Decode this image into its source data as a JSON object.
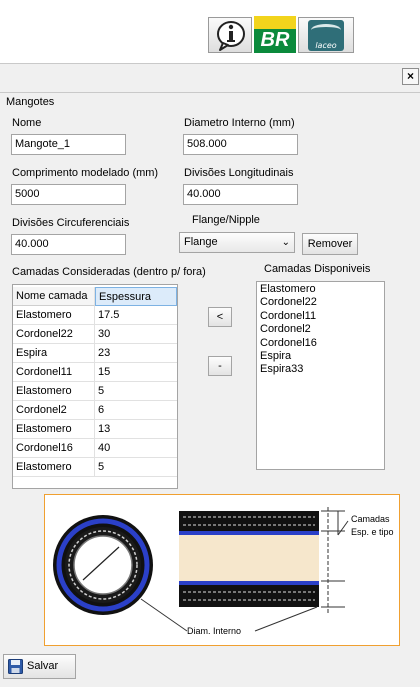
{
  "toolbar": {
    "info_icon": "info-icon",
    "br_logo_text": "BR",
    "laceo_logo_text": "laceo"
  },
  "close_label": "×",
  "group_title": "Mangotes",
  "form": {
    "nome_label": "Nome",
    "nome_value": "Mangote_1",
    "diametro_label": "Diametro Interno (mm)",
    "diametro_value": "508.000",
    "comprimento_label": "Comprimento modelado (mm)",
    "comprimento_value": "5000",
    "div_long_label": "Divisões Longitudinais",
    "div_long_value": "40.000",
    "div_circ_label": "Divisões Circuferenciais",
    "div_circ_value": "40.000",
    "flange_label": "Flange/Nipple",
    "flange_value": "Flange",
    "remover_label": "Remover"
  },
  "camadas_consideradas": {
    "title": "Camadas Consideradas (dentro p/ fora)",
    "headers": [
      "Nome camada",
      "Espessura"
    ],
    "rows": [
      [
        "Elastomero",
        "17.5"
      ],
      [
        "Cordonel22",
        "30"
      ],
      [
        "Espira",
        "23"
      ],
      [
        "Cordonel11",
        "15"
      ],
      [
        "Elastomero",
        "5"
      ],
      [
        "Cordonel2",
        "6"
      ],
      [
        "Elastomero",
        "13"
      ],
      [
        "Cordonel16",
        "40"
      ],
      [
        "Elastomero",
        "5"
      ]
    ]
  },
  "move_left_label": "<",
  "remove_label": "-",
  "camadas_disponiveis": {
    "title": "Camadas Disponiveis",
    "items": [
      "Elastomero",
      "Cordonel22",
      "Cordonel11",
      "Cordonel2",
      "Cordonel16",
      "Espira",
      "Espira33"
    ]
  },
  "diagram": {
    "label_camadas": "Camadas",
    "label_esp": "Esp. e tipo",
    "label_diam": "Diam. Interno"
  },
  "save_label": "Salvar"
}
